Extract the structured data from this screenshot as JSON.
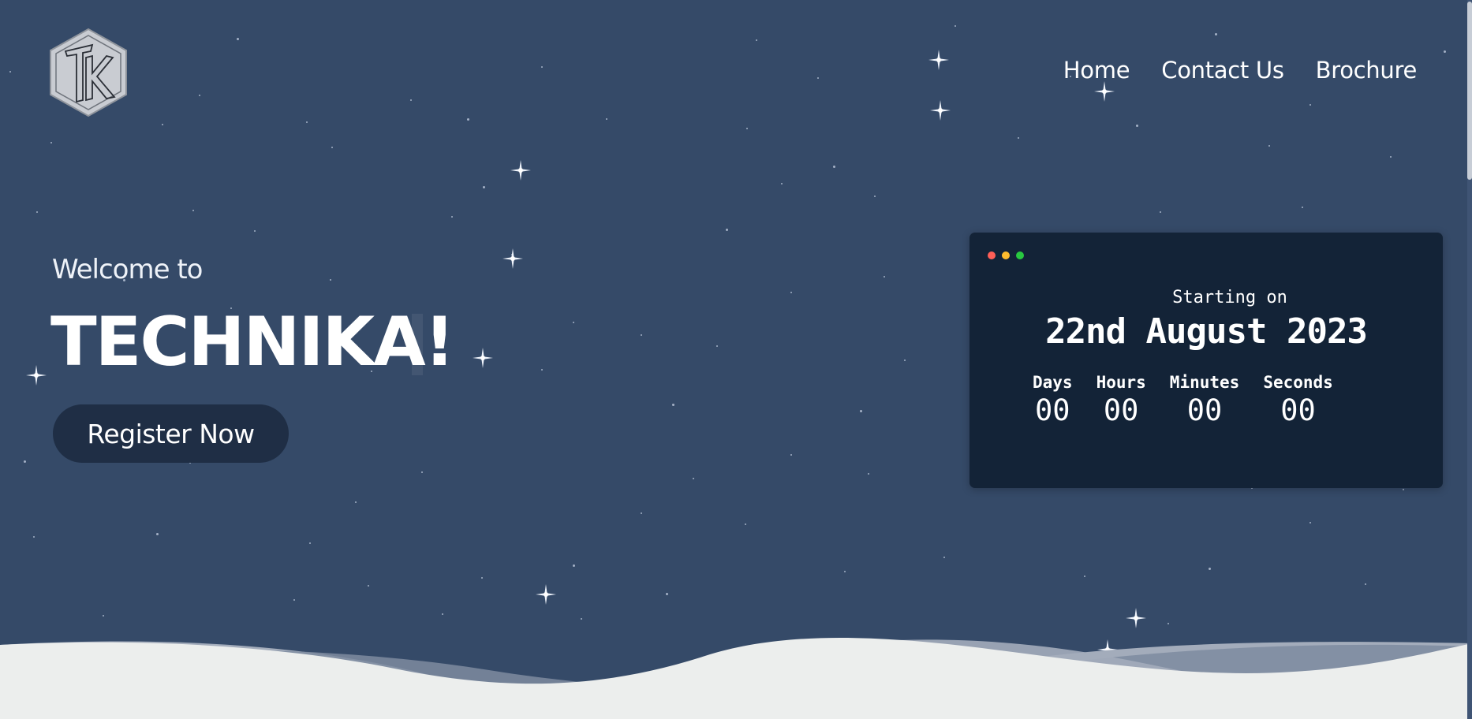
{
  "logo": {
    "text": "TK",
    "icon": "tk-hexagon-logo"
  },
  "nav": {
    "items": [
      {
        "label": "Home"
      },
      {
        "label": "Contact Us"
      },
      {
        "label": "Brochure"
      }
    ]
  },
  "hero": {
    "welcome": "Welcome to",
    "title": "TECHNIKA!",
    "register_label": "Register Now"
  },
  "countdown": {
    "label": "Starting on",
    "date": "22nd August 2023",
    "units": [
      {
        "label": "Days",
        "value": "00"
      },
      {
        "label": "Hours",
        "value": "00"
      },
      {
        "label": "Minutes",
        "value": "00"
      },
      {
        "label": "Seconds",
        "value": "00"
      }
    ],
    "window_dots": [
      "#ff5f57",
      "#febc2e",
      "#28c840"
    ]
  },
  "colors": {
    "background": "#354a68",
    "card": "#132337",
    "button": "#1f2e45",
    "ground": "#eceeed"
  }
}
